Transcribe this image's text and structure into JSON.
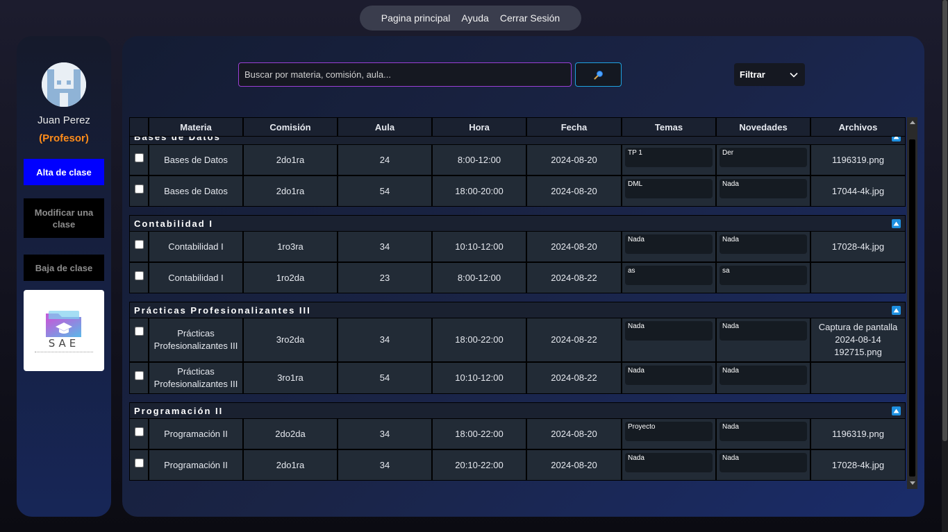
{
  "nav": {
    "home": "Pagina principal",
    "help": "Ayuda",
    "logout": "Cerrar Sesión"
  },
  "user": {
    "name": "Juan Perez",
    "role": "(Profesor)"
  },
  "sidebar": {
    "alta": "Alta de clase",
    "modificar": "Modificar una clase",
    "baja": "Baja de clase",
    "logo_text": "SAE"
  },
  "search": {
    "placeholder": "Buscar por materia, comisión, aula...",
    "value": ""
  },
  "filter": {
    "label": "Filtrar"
  },
  "table": {
    "headers": [
      "",
      "Materia",
      "Comisión",
      "Aula",
      "Hora",
      "Fecha",
      "Temas",
      "Novedades",
      "Archivos"
    ],
    "groups": [
      {
        "name": "Bases de Datos",
        "rows": [
          {
            "materia": "Bases de Datos",
            "comision": "2do1ra",
            "aula": "24",
            "hora": "8:00-12:00",
            "fecha": "2024-08-20",
            "temas": "TP 1",
            "novedades": "Der",
            "archivos": "1196319.png"
          },
          {
            "materia": "Bases de Datos",
            "comision": "2do1ra",
            "aula": "54",
            "hora": "18:00-20:00",
            "fecha": "2024-08-20",
            "temas": "DML",
            "novedades": "Nada",
            "archivos": "17044-4k.jpg"
          }
        ]
      },
      {
        "name": "Contabilidad I",
        "rows": [
          {
            "materia": "Contabilidad I",
            "comision": "1ro3ra",
            "aula": "34",
            "hora": "10:10-12:00",
            "fecha": "2024-08-20",
            "temas": "Nada",
            "novedades": "Nada",
            "archivos": "17028-4k.jpg"
          },
          {
            "materia": "Contabilidad I",
            "comision": "1ro2da",
            "aula": "23",
            "hora": "8:00-12:00",
            "fecha": "2024-08-22",
            "temas": "as",
            "novedades": "sa",
            "archivos": ""
          }
        ]
      },
      {
        "name": "Prácticas Profesionalizantes III",
        "rows": [
          {
            "materia": "Prácticas Profesionalizantes III",
            "comision": "3ro2da",
            "aula": "34",
            "hora": "18:00-22:00",
            "fecha": "2024-08-22",
            "temas": "Nada",
            "novedades": "Nada",
            "archivos": "Captura de pantalla 2024-08-14 192715.png"
          },
          {
            "materia": "Prácticas Profesionalizantes III",
            "comision": "3ro1ra",
            "aula": "54",
            "hora": "10:10-12:00",
            "fecha": "2024-08-22",
            "temas": "Nada",
            "novedades": "Nada",
            "archivos": ""
          }
        ]
      },
      {
        "name": "Programación II",
        "rows": [
          {
            "materia": "Programación II",
            "comision": "2do2da",
            "aula": "34",
            "hora": "18:00-22:00",
            "fecha": "2024-08-20",
            "temas": "Proyecto",
            "novedades": "Nada",
            "archivos": "1196319.png"
          },
          {
            "materia": "Programación II",
            "comision": "2do1ra",
            "aula": "34",
            "hora": "20:10-22:00",
            "fecha": "2024-08-20",
            "temas": "Nada",
            "novedades": "Nada",
            "archivos": "17028-4k.jpg"
          }
        ]
      }
    ]
  },
  "colors": {
    "accent_blue": "#0000ff",
    "role_orange": "#ff8c1a",
    "search_border": "#9b3fd6",
    "search_btn_border": "#1fa3e0",
    "collapse_icon": "#1e90e0"
  },
  "icons": {
    "search": "magnifier-icon",
    "filter": "chevron-down-icon",
    "collapse": "triangle-up-icon"
  }
}
